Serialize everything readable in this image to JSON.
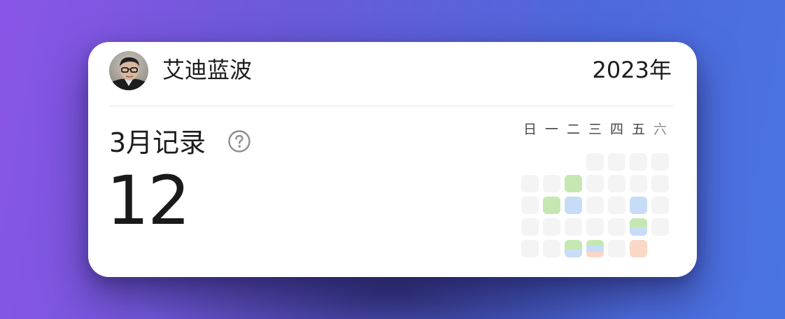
{
  "header": {
    "user_name": "艾迪蓝波",
    "year": "2023年"
  },
  "summary": {
    "title": "3月记录",
    "count": "12",
    "help_icon": "question-circle-icon"
  },
  "calendar": {
    "weekdays": [
      "日",
      "一",
      "二",
      "三",
      "四",
      "五",
      "六"
    ],
    "leading_blank_days": 3,
    "days_in_month": 31,
    "empty_color": "#f4f4f5",
    "category_colors": {
      "green": "#c5e8b2",
      "blue": "#c7ddf7",
      "orange": "#fbd7c6"
    },
    "entries": [
      {
        "day": 7,
        "categories": [
          "green"
        ]
      },
      {
        "day": 13,
        "categories": [
          "green"
        ]
      },
      {
        "day": 14,
        "categories": [
          "blue"
        ]
      },
      {
        "day": 17,
        "categories": [
          "blue"
        ]
      },
      {
        "day": 24,
        "categories": [
          "green",
          "blue"
        ]
      },
      {
        "day": 28,
        "categories": [
          "green",
          "blue"
        ]
      },
      {
        "day": 29,
        "categories": [
          "green",
          "blue",
          "orange"
        ]
      },
      {
        "day": 31,
        "categories": [
          "orange"
        ]
      }
    ]
  }
}
